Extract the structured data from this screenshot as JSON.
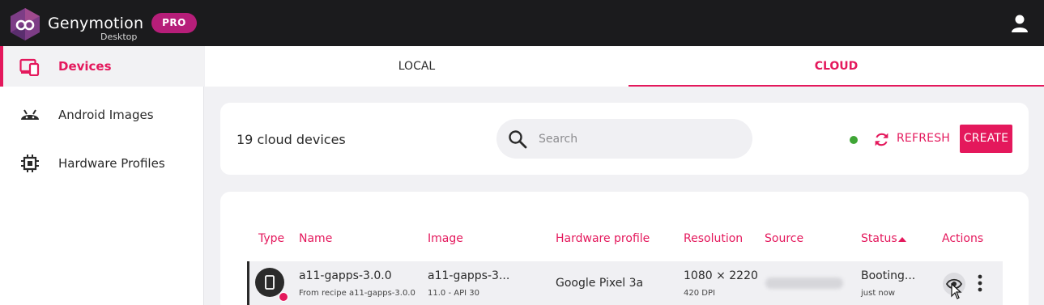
{
  "brand": {
    "name": "Genymotion",
    "subtitle": "Desktop",
    "badge": "PRO"
  },
  "sidebar": {
    "items": [
      {
        "label": "Devices",
        "icon": "devices-icon",
        "active": true
      },
      {
        "label": "Android Images",
        "icon": "android-icon",
        "active": false
      },
      {
        "label": "Hardware Profiles",
        "icon": "chip-icon",
        "active": false
      }
    ]
  },
  "tabs": [
    {
      "label": "LOCAL",
      "active": false
    },
    {
      "label": "CLOUD",
      "active": true
    }
  ],
  "toolbar": {
    "count_text": "19 cloud devices",
    "search_placeholder": "Search",
    "search_value": "",
    "refresh_label": "REFRESH",
    "create_label": "CREATE"
  },
  "table": {
    "columns": [
      "Type",
      "Name",
      "Image",
      "Hardware profile",
      "Resolution",
      "Source",
      "Status",
      "Actions"
    ],
    "sorted_column": "Status",
    "sort_direction": "ascending",
    "rows": [
      {
        "name": "a11-gapps-3.0.0",
        "name_sub": "From recipe a11-gapps-3.0.0",
        "image": "a11-gapps-3...",
        "image_sub": "11.0 - API 30",
        "hardware_profile": "Google Pixel 3a",
        "resolution": "1080 × 2220",
        "resolution_sub": "420 DPI",
        "status": "Booting...",
        "status_sub": "just now"
      }
    ]
  },
  "colors": {
    "accent": "#e4185c",
    "topbar": "#1b1b1d",
    "pro_badge": "#b61e79",
    "status_online": "#3fa535"
  }
}
